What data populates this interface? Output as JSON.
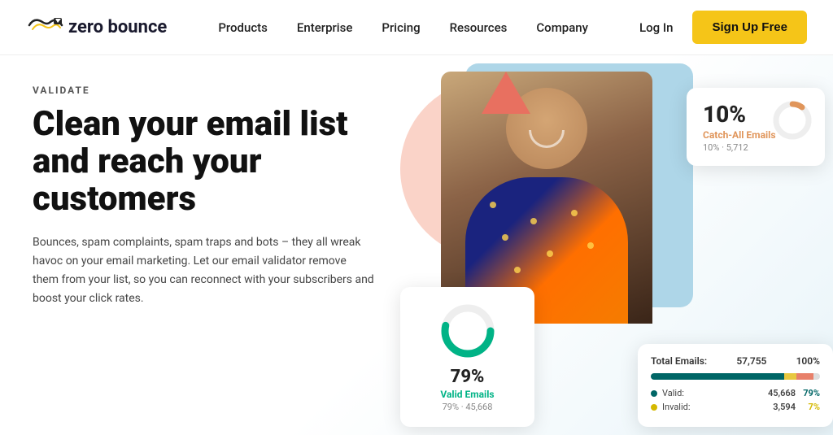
{
  "navbar": {
    "logo_text": "zero bounce",
    "links": [
      "Products",
      "Enterprise",
      "Pricing",
      "Resources",
      "Company"
    ],
    "login_label": "Log In",
    "signup_label": "Sign Up Free"
  },
  "hero": {
    "validate_label": "VALIDATE",
    "title": "Clean your email list and reach your customers",
    "description": "Bounces, spam complaints, spam traps and bots – they all wreak havoc on your email marketing. Let our email validator remove them from your list, so you can reconnect with your subscribers and boost your click rates."
  },
  "card_catchall": {
    "percent": "10%",
    "label": "Catch-All Emails",
    "detail": "10% · 5,712"
  },
  "card_valid": {
    "percent": "79%",
    "label": "Valid Emails",
    "detail": "79% · 45,668"
  },
  "card_stats": {
    "header_label": "Total Emails:",
    "header_count": "57,755",
    "header_pct": "100%",
    "rows": [
      {
        "dot_color": "#006666",
        "label": "Valid:",
        "val": "45,668",
        "pct": "79%",
        "pct_color": "#006666"
      },
      {
        "dot_color": "#d4b800",
        "label": "Invalid:",
        "val": "3,594",
        "pct": "7%",
        "pct_color": "#d4b800"
      }
    ],
    "progress_segments": [
      {
        "class": "pb-valid",
        "width": "79%"
      },
      {
        "class": "pb-invalid",
        "width": "7%"
      },
      {
        "class": "pb-catchall",
        "width": "10%"
      },
      {
        "class": "pb-other",
        "width": "4%"
      }
    ]
  }
}
